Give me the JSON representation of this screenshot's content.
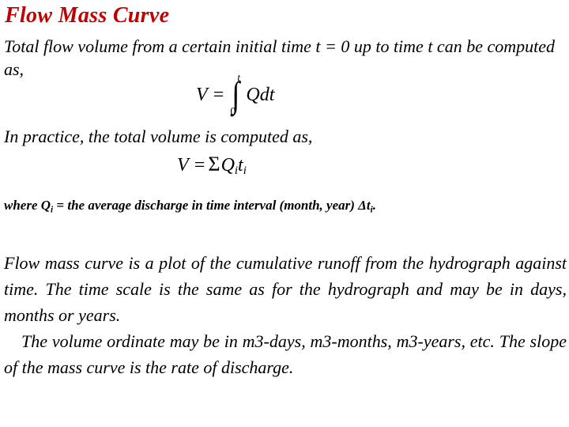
{
  "slide": {
    "background_color": "#FFFFFF",
    "title": {
      "text": "Flow Mass Curve",
      "color": "#C00000"
    },
    "intro_paragraph": "Total flow volume from a certain initial time t = 0 up to time t can be computed as,",
    "equation_1": {
      "lhs": "V =",
      "integral_symbol": "∫",
      "upper_limit": "t",
      "lower_limit": "0",
      "integrand": "Qdt",
      "plain": "V = ∫0t Qdt"
    },
    "practice_line": "In practice, the total volume is computed as,",
    "equation_2": {
      "lhs": "V =",
      "sigma_symbol": "Σ",
      "term_1": "Q",
      "term_1_sub": "i",
      "term_2": "t",
      "term_2_sub": "i",
      "plain": "V = Σ Qi ti"
    },
    "where_note": {
      "prefix": "where Q",
      "subscript": "i",
      "middle": " = the average discharge in time interval (month, year) Δt",
      "subscript_2": "i",
      "suffix": ".",
      "plain": "where Qi = the average discharge in time interval (month, year) Δti."
    },
    "body_paragraphs": [
      "Flow mass curve is a plot of the cumulative runoff from the hydrograph against time. The time scale is the same as for the hydrograph and may be in days, months or years.",
      "The volume ordinate may be in m3-days, m3-months, m3-years, etc. The slope of the mass curve is the rate of discharge."
    ]
  }
}
